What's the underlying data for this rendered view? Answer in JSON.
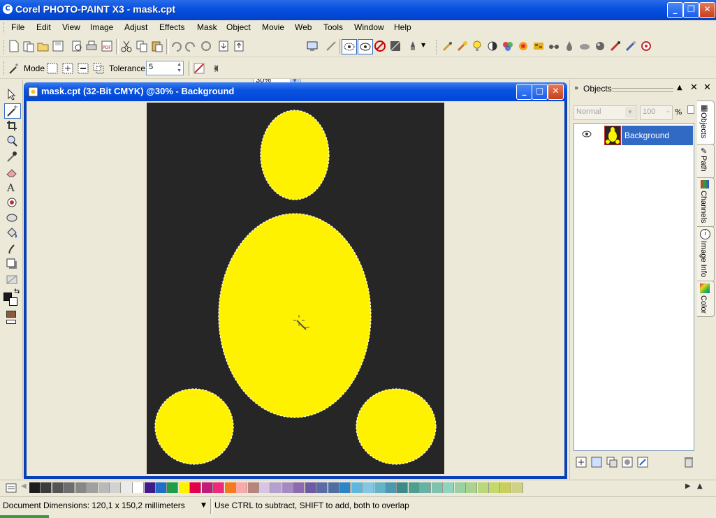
{
  "app": {
    "title": "Corel PHOTO-PAINT X3 - mask.cpt",
    "icon": "corel-balloon-icon"
  },
  "menu": [
    "File",
    "Edit",
    "View",
    "Image",
    "Adjust",
    "Effects",
    "Mask",
    "Object",
    "Movie",
    "Web",
    "Tools",
    "Window",
    "Help"
  ],
  "toolbar": {
    "zoom_value": "30%"
  },
  "property_bar": {
    "mode_label": "Mode",
    "tolerance_label": "Tolerance",
    "tolerance_value": "5"
  },
  "document": {
    "title": "mask.cpt (32-Bit CMYK) @30% - Background"
  },
  "objects_docker": {
    "title": "Objects",
    "blend_mode": "Normal",
    "opacity": "100",
    "percent_sign": "%",
    "layers": [
      {
        "name": "Background",
        "visible": true
      }
    ],
    "tabs": [
      "Objects",
      "Path",
      "Channels",
      "Image Info",
      "Color"
    ]
  },
  "palette": {
    "colors": [
      "#1c1c1c",
      "#3c3c3c",
      "#555555",
      "#6e6e6e",
      "#878787",
      "#a0a0a0",
      "#b9b9b9",
      "#d2d2d2",
      "#ebebeb",
      "#ffffff",
      "#3f1b8c",
      "#1f6fc6",
      "#1f9d49",
      "#fff200",
      "#e6004c",
      "#c41a7a",
      "#ee2a7b",
      "#f47a20",
      "#f9a9a9",
      "#b7857e",
      "#d8c4e4",
      "#b5a1d0",
      "#a58bc4",
      "#8e6bb0",
      "#6c5aa6",
      "#5a6ba8",
      "#4f6fa0",
      "#2c85c8",
      "#5fb7e0",
      "#82c7e6",
      "#64b3c9",
      "#4b98b3",
      "#3c8a8a",
      "#4f9e90",
      "#66b3a6",
      "#7dc3b0",
      "#8ed4bf",
      "#9ad0a2",
      "#a8d48e",
      "#b8d879",
      "#c4d96a",
      "#c9cf5a",
      "#cfd08a"
    ]
  },
  "status": {
    "dimensions": "Document Dimensions: 120,1 x 150,2 millimeters",
    "hint": "Use CTRL to subtract, SHIFT to add, both to overlap"
  },
  "colors": {
    "image_bg": "#262626",
    "shape_fill": "#fff200",
    "selection": "#316ac5",
    "titlebar": "#0a53e0"
  }
}
